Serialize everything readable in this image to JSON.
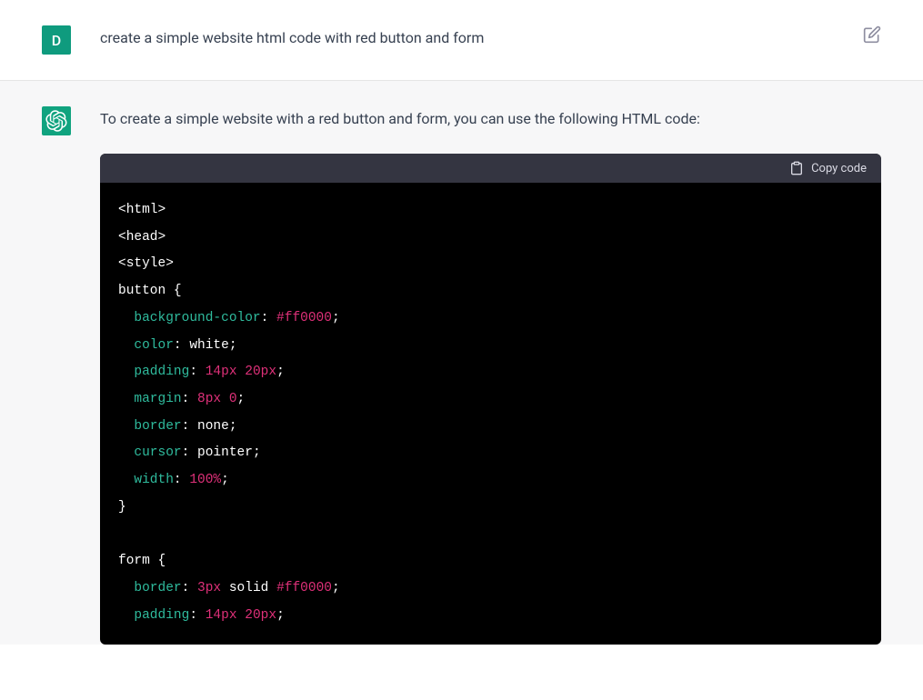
{
  "user": {
    "avatar_letter": "D",
    "message": "create a simple website html code with red button and form"
  },
  "assistant": {
    "message": "To create a simple website with a red button and form, you can use the following HTML code:"
  },
  "code_block": {
    "copy_label": "Copy code",
    "lines": {
      "l1": "<html>",
      "l2": "<head>",
      "l3": "<style>",
      "l4_sel": "button ",
      "l4_brace": "{",
      "l5_prop": "background-color",
      "l5_val": "#ff0000",
      "l6_prop": "color",
      "l6_val": "white",
      "l7_prop": "padding",
      "l7_val1": "14px",
      "l7_val2": "20px",
      "l8_prop": "margin",
      "l8_val1": "8px",
      "l8_val2": "0",
      "l9_prop": "border",
      "l9_val": "none",
      "l10_prop": "cursor",
      "l10_val": "pointer",
      "l11_prop": "width",
      "l11_val": "100%",
      "l12_brace": "}",
      "l13_sel": "form ",
      "l13_brace": "{",
      "l14_prop": "border",
      "l14_val1": "3px",
      "l14_val2": "solid",
      "l14_val3": "#ff0000",
      "l15_prop": "padding",
      "l15_val1": "14px",
      "l15_val2": "20px"
    }
  }
}
